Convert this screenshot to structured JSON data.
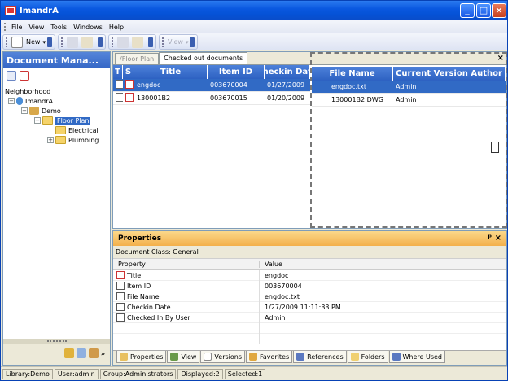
{
  "window": {
    "title": "ImandrA"
  },
  "menu": [
    "File",
    "View",
    "Tools",
    "Windows",
    "Help"
  ],
  "toolbar": {
    "new_label": "New",
    "view_label": "View"
  },
  "left": {
    "header": "Document Mana...",
    "tree": {
      "root": "Neighborhood",
      "server": "ImandrA",
      "library": "Demo",
      "selected": "Floor Plan",
      "child1": "Electrical",
      "child2": "Plumbing"
    }
  },
  "tabs": [
    "/Floor Plan",
    "Checked out documents"
  ],
  "grid": {
    "columns": [
      "T",
      "S",
      "Title",
      "Item ID",
      "Checkin Date",
      "File Name",
      "Current Version Author"
    ],
    "rows": [
      {
        "title": "engdoc",
        "item_id": "003670004",
        "checkin": "01/27/2009",
        "file_name": "engdoc.txt",
        "author": "Admin",
        "selected": true
      },
      {
        "title": "130001B2",
        "item_id": "003670015",
        "checkin": "01/20/2009",
        "file_name": "130001B2.DWG",
        "author": "Admin",
        "selected": false
      }
    ]
  },
  "properties": {
    "header": "Properties",
    "doc_class": "Document Class: General",
    "col_property": "Property",
    "col_value": "Value",
    "rows": [
      {
        "name": "Title",
        "value": "engdoc"
      },
      {
        "name": "Item ID",
        "value": "003670004"
      },
      {
        "name": "File Name",
        "value": "engdoc.txt"
      },
      {
        "name": "Checkin Date",
        "value": "1/27/2009 11:11:33 PM"
      },
      {
        "name": "Checked In By User",
        "value": "Admin"
      }
    ],
    "tabs": [
      "Properties",
      "View",
      "Versions",
      "Favorites",
      "References",
      "Folders",
      "Where Used"
    ]
  },
  "status": [
    "Library:Demo",
    "User:admin",
    "Group:Administrators",
    "Displayed:2",
    "Selected:1"
  ],
  "colors": {
    "titlebar": "#0a58e0",
    "selection": "#316ac5",
    "grid_header": "#3567c6",
    "props_header": "#f3b04b"
  }
}
